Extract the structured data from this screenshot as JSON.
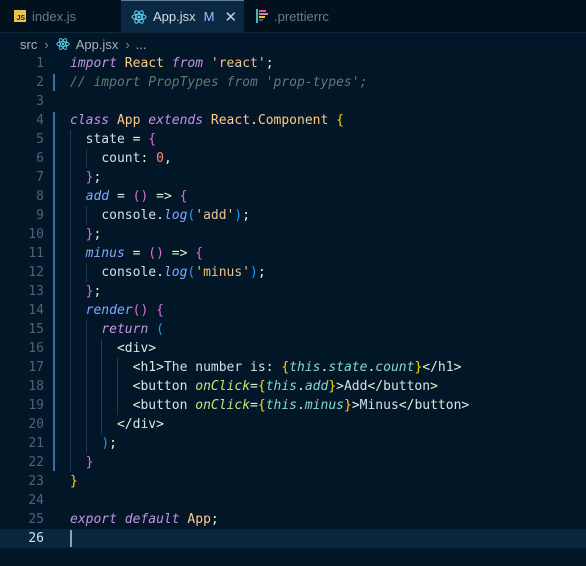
{
  "tabs": [
    {
      "label": "index.js",
      "icon": "js-file-icon",
      "active": false
    },
    {
      "label": "App.jsx",
      "icon": "react-icon",
      "active": true,
      "status": "M"
    },
    {
      "label": ".prettierrc",
      "icon": "prettier-icon",
      "active": false
    }
  ],
  "breadcrumb": {
    "folder": "src",
    "file": "App.jsx",
    "more": "..."
  },
  "current_line": 26,
  "lines": [
    {
      "n": "1",
      "code": "import React from 'react';"
    },
    {
      "n": "2",
      "code": "// import PropTypes from 'prop-types';"
    },
    {
      "n": "3",
      "code": ""
    },
    {
      "n": "4",
      "code": "class App extends React.Component {"
    },
    {
      "n": "5",
      "code": "  state = {"
    },
    {
      "n": "6",
      "code": "    count: 0,"
    },
    {
      "n": "7",
      "code": "  };"
    },
    {
      "n": "8",
      "code": "  add = () => {"
    },
    {
      "n": "9",
      "code": "    console.log('add');"
    },
    {
      "n": "10",
      "code": "  };"
    },
    {
      "n": "11",
      "code": "  minus = () => {"
    },
    {
      "n": "12",
      "code": "    console.log('minus');"
    },
    {
      "n": "13",
      "code": "  };"
    },
    {
      "n": "14",
      "code": "  render() {"
    },
    {
      "n": "15",
      "code": "    return ("
    },
    {
      "n": "16",
      "code": "      <div>"
    },
    {
      "n": "17",
      "code": "        <h1>The number is: {this.state.count}</h1>"
    },
    {
      "n": "18",
      "code": "        <button onClick={this.add}>Add</button>"
    },
    {
      "n": "19",
      "code": "        <button onClick={this.minus}>Minus</button>"
    },
    {
      "n": "20",
      "code": "      </div>"
    },
    {
      "n": "21",
      "code": "    );"
    },
    {
      "n": "22",
      "code": "  }"
    },
    {
      "n": "23",
      "code": "}"
    },
    {
      "n": "24",
      "code": ""
    },
    {
      "n": "25",
      "code": "export default App;"
    },
    {
      "n": "26",
      "code": ""
    }
  ]
}
